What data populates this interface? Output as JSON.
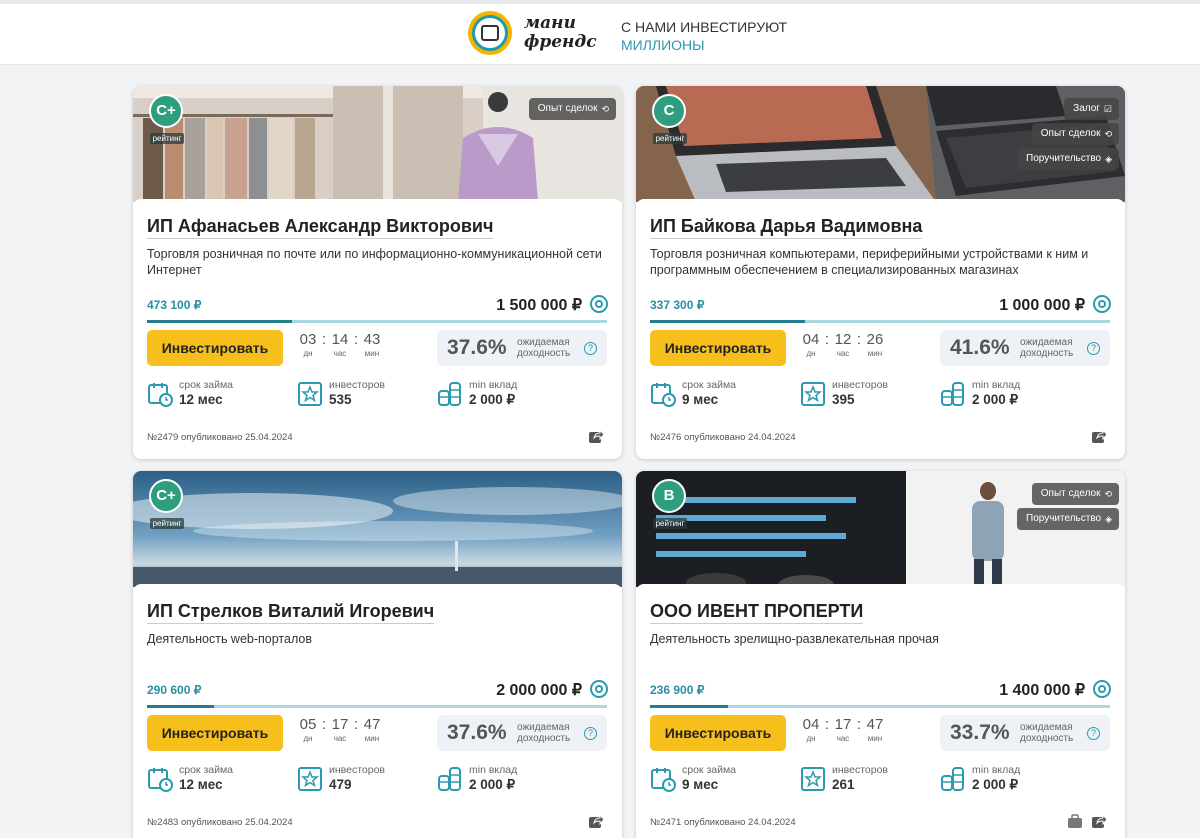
{
  "header": {
    "logo_line1": "мани",
    "logo_line2": "френдс",
    "slogan_line1": "С НАМИ ИНВЕСТИРУЮТ",
    "slogan_line2": "МИЛЛИОНЫ"
  },
  "colors": {
    "accent": "#2a9aaf",
    "button": "#f7bf1b",
    "rating": "#2f9e7e",
    "progress_fill": "#237f8f",
    "progress_track": "#a9d7df"
  },
  "icons": {
    "term": "calendar-clock-icon",
    "investors": "star-square-icon",
    "min_deposit": "coins-stack-icon",
    "goal": "target-icon",
    "share": "share-icon",
    "yield_help": "question-icon"
  },
  "cards": [
    {
      "rating": "C+",
      "rating_label": "рейтинг",
      "badges": [
        "Опыт сделок"
      ],
      "name": "ИП Афанасьев Александр Викторович",
      "activity": "Торговля розничная по почте или по информационно-коммуникационной сети Интернет",
      "raised": "473 100 ₽",
      "goal": "1 500 000 ₽",
      "progress": 0.315,
      "invest_label": "Инвестировать",
      "timer": {
        "d": "03",
        "h": "14",
        "m": "43",
        "d_label": "дн",
        "h_label": "час",
        "m_label": "мин"
      },
      "yield": "37.6%",
      "yield_caption1": "ожидаемая",
      "yield_caption2": "доходность",
      "term_label": "срок займа",
      "term": "12 мес",
      "investors_label": "инвесторов",
      "investors": "535",
      "min_label": "min вклад",
      "min_deposit": "2 000 ₽",
      "footer": "№2479 опубликовано 25.04.2024"
    },
    {
      "rating": "C",
      "rating_label": "рейтинг",
      "badges": [
        "Залог",
        "Опыт сделок",
        "Поручительство"
      ],
      "name": "ИП Байкова Дарья Вадимовна",
      "activity": "Торговля розничная компьютерами, периферийными устройствами к ним и программным обеспечением в специализированных магазинах",
      "raised": "337 300 ₽",
      "goal": "1 000 000 ₽",
      "progress": 0.337,
      "invest_label": "Инвестировать",
      "timer": {
        "d": "04",
        "h": "12",
        "m": "26",
        "d_label": "дн",
        "h_label": "час",
        "m_label": "мин"
      },
      "yield": "41.6%",
      "yield_caption1": "ожидаемая",
      "yield_caption2": "доходность",
      "term_label": "срок займа",
      "term": "9 мес",
      "investors_label": "инвесторов",
      "investors": "395",
      "min_label": "min вклад",
      "min_deposit": "2 000 ₽",
      "footer": "№2476 опубликовано 24.04.2024"
    },
    {
      "rating": "C+",
      "rating_label": "рейтинг",
      "badges": [],
      "name": "ИП Стрелков Виталий Игоревич",
      "activity": "Деятельность web-порталов",
      "raised": "290 600 ₽",
      "goal": "2 000 000 ₽",
      "progress": 0.145,
      "invest_label": "Инвестировать",
      "timer": {
        "d": "05",
        "h": "17",
        "m": "47",
        "d_label": "дн",
        "h_label": "час",
        "m_label": "мин"
      },
      "yield": "37.6%",
      "yield_caption1": "ожидаемая",
      "yield_caption2": "доходность",
      "term_label": "срок займа",
      "term": "12 мес",
      "investors_label": "инвесторов",
      "investors": "479",
      "min_label": "min вклад",
      "min_deposit": "2 000 ₽",
      "footer": "№2483 опубликовано 25.04.2024"
    },
    {
      "rating": "B",
      "rating_label": "рейтинг",
      "badges": [
        "Опыт сделок",
        "Поручительство"
      ],
      "name": "ООО ИВЕНТ ПРОПЕРТИ",
      "activity": "Деятельность зрелищно-развлекательная прочая",
      "raised": "236 900 ₽",
      "goal": "1 400 000 ₽",
      "progress": 0.169,
      "invest_label": "Инвестировать",
      "timer": {
        "d": "04",
        "h": "17",
        "m": "47",
        "d_label": "дн",
        "h_label": "час",
        "m_label": "мин"
      },
      "yield": "33.7%",
      "yield_caption1": "ожидаемая",
      "yield_caption2": "доходность",
      "term_label": "срок займа",
      "term": "9 мес",
      "investors_label": "инвесторов",
      "investors": "261",
      "min_label": "min вклад",
      "min_deposit": "2 000 ₽",
      "footer": "№2471 опубликовано 24.04.2024"
    }
  ]
}
